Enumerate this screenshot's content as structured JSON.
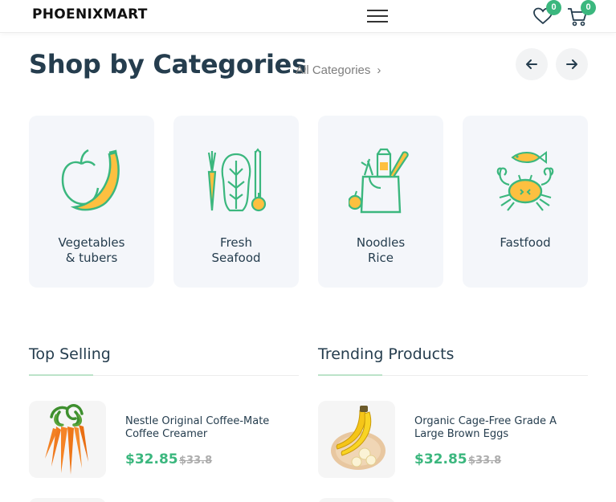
{
  "header": {
    "logo": "PHOENIXMART",
    "wishlist_count": "0",
    "cart_count": "0",
    "icons": [
      "menu-icon",
      "heart-icon",
      "cart-icon"
    ]
  },
  "categories_section": {
    "title": "Shop by Categories",
    "all_link": "All Categories",
    "prev_icon": "arrow-left-icon",
    "next_icon": "arrow-right-icon",
    "items": [
      {
        "label": "Vegetables\n& tubers",
        "icon": "apple-banana-icon"
      },
      {
        "label": "Fresh\nSeafood",
        "icon": "vegetables-icon"
      },
      {
        "label": "Noodles\nRice",
        "icon": "grocery-bag-icon"
      },
      {
        "label": "Fastfood",
        "icon": "seafood-crab-icon"
      }
    ]
  },
  "top_selling": {
    "title": "Top Selling",
    "products": [
      {
        "name": "Nestle Original Coffee-Mate Coffee Creamer",
        "price": "$32.85",
        "old_price": "$33.8",
        "image": "carrots"
      }
    ]
  },
  "trending": {
    "title": "Trending Products",
    "products": [
      {
        "name": "Organic Cage-Free Grade A Large Brown Eggs",
        "price": "$32.85",
        "old_price": "$33.8",
        "image": "bananas"
      }
    ]
  },
  "colors": {
    "brand_green": "#3bb77e",
    "heading": "#253d4e",
    "card_bg": "#f4f6fa",
    "accent_yellow": "#fdc040"
  }
}
